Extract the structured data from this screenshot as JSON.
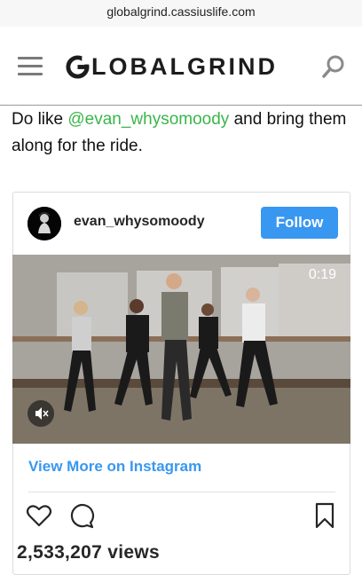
{
  "browser": {
    "url": "globalgrind.cassiuslife.com"
  },
  "header": {
    "logo_text": "LOBALGRIND",
    "icons": [
      "hamburger-menu-icon",
      "logo-g-icon",
      "search-icon"
    ]
  },
  "article": {
    "text_before": "Do like ",
    "mention": "@evan_whysomoody",
    "text_after": " and bring them along for the ride."
  },
  "instagram_embed": {
    "username": "evan_whysomoody",
    "follow_label": "Follow",
    "video_time": "0:19",
    "view_more_label": "View More on Instagram",
    "views": "2,533,207 views",
    "icons": [
      "avatar",
      "mute-icon",
      "heart-icon",
      "comment-icon",
      "bookmark-icon"
    ]
  },
  "colors": {
    "mention": "#3ab54a",
    "follow_button": "#3897f0",
    "link": "#3897f0",
    "text": "#111111"
  }
}
